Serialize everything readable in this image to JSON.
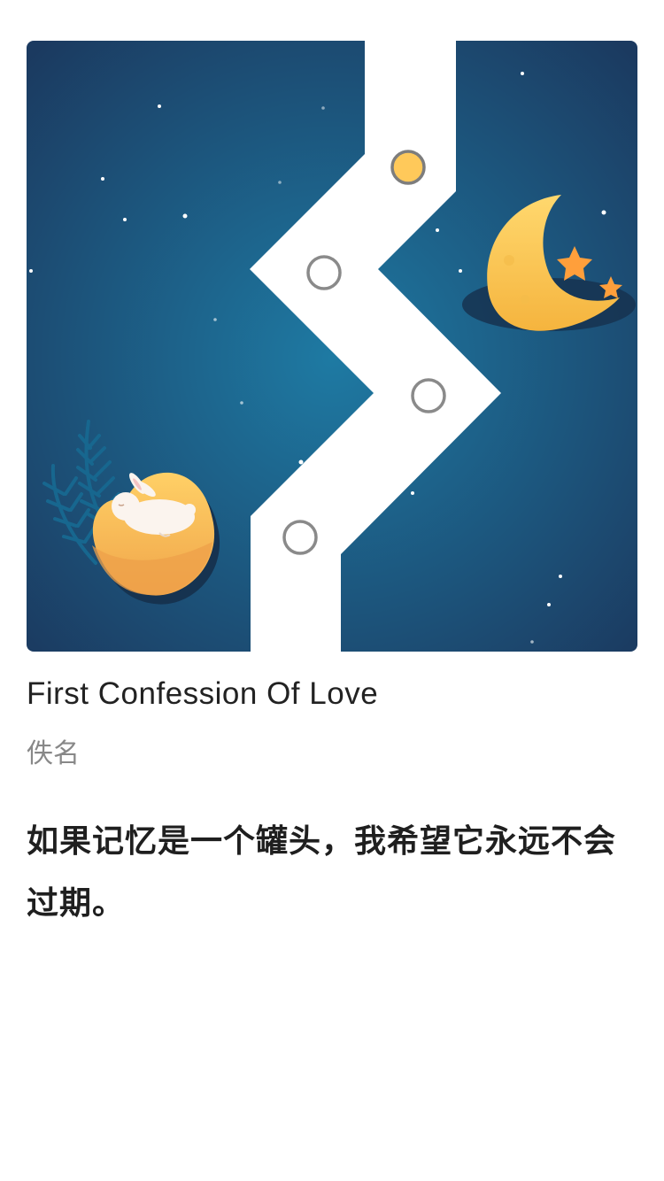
{
  "poem": {
    "title": "First Confession Of Love",
    "author": "佚名",
    "quote": "如果记忆是一个罐头，我希望它永远不会过期。"
  },
  "artwork": {
    "icons": [
      "zigzag-path",
      "level-node",
      "crescent-moon-icon",
      "star-icon",
      "rabbit-icon",
      "mooncake-icon",
      "leaf-icon"
    ],
    "colors": {
      "background_dark": "#1b3a60",
      "background_light": "#1e7aa3",
      "path": "#ffffff",
      "node_active": "#ffc95a",
      "node_ring": "#8a8a8a",
      "moon": "#ffcf5c",
      "star": "#ff9f3b",
      "leaf": "#17678f"
    }
  }
}
